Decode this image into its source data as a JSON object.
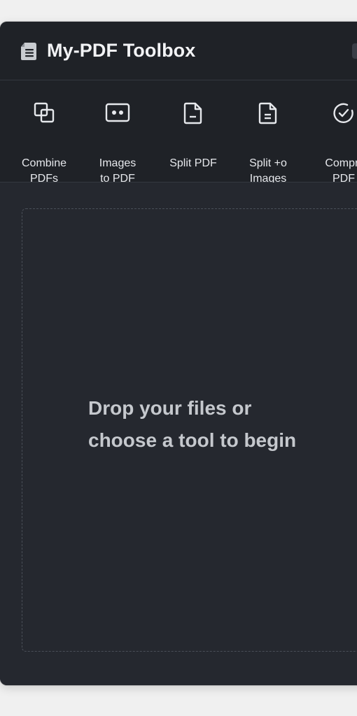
{
  "app": {
    "title": "My-PDF Toolbox"
  },
  "tools": [
    {
      "label": "Combine\nPDFs",
      "icon": "combine-icon"
    },
    {
      "label": "Images\nto PDF",
      "icon": "image-icon"
    },
    {
      "label": "Split PDF",
      "icon": "document-icon"
    },
    {
      "label": "Split  +o\nImages",
      "icon": "document-lines-icon"
    },
    {
      "label": "Compr‑\nPDF",
      "icon": "check-circle-icon"
    }
  ],
  "dropzone": {
    "message": "Drop your files or\nchoose a tool to begin"
  },
  "colors": {
    "window_bg": "#25282f",
    "toolbar_bg": "#1f2227",
    "text_primary": "#f2f3f5",
    "text_muted": "#c5c8cd",
    "icon_stroke": "#e6e8ec"
  }
}
